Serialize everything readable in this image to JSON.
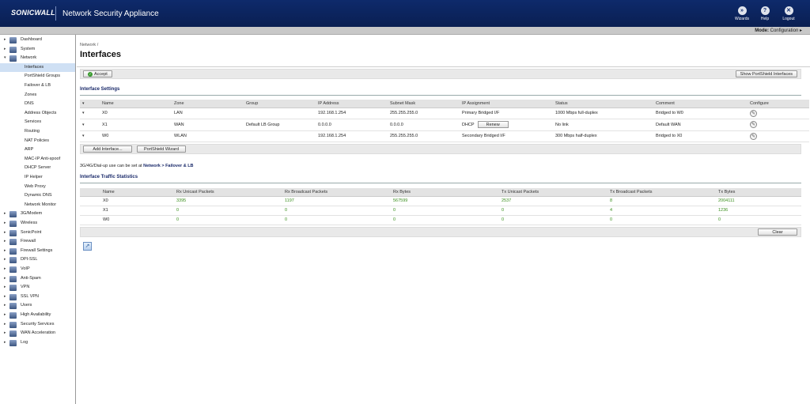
{
  "header": {
    "logo": "SONICWALL",
    "title": "Network Security Appliance",
    "buttons": [
      {
        "label": "Wizards",
        "icon": "wizard-icon"
      },
      {
        "label": "Help",
        "icon": "help-icon"
      },
      {
        "label": "Logout",
        "icon": "logout-icon"
      }
    ]
  },
  "mode": {
    "label": "Mode:",
    "value": "Configuration ▸"
  },
  "sidebar": {
    "items": [
      {
        "label": "Dashboard",
        "level": 0
      },
      {
        "label": "System",
        "level": 0
      },
      {
        "label": "Network",
        "level": 0,
        "expanded": true
      },
      {
        "label": "Interfaces",
        "level": 1,
        "active": true
      },
      {
        "label": "PortShield Groups",
        "level": 1
      },
      {
        "label": "Failover & LB",
        "level": 1
      },
      {
        "label": "Zones",
        "level": 1
      },
      {
        "label": "DNS",
        "level": 1
      },
      {
        "label": "Address Objects",
        "level": 1
      },
      {
        "label": "Services",
        "level": 1
      },
      {
        "label": "Routing",
        "level": 1
      },
      {
        "label": "NAT Policies",
        "level": 1
      },
      {
        "label": "ARP",
        "level": 1
      },
      {
        "label": "MAC-IP Anti-spoof",
        "level": 1
      },
      {
        "label": "DHCP Server",
        "level": 1
      },
      {
        "label": "IP Helper",
        "level": 1
      },
      {
        "label": "Web Proxy",
        "level": 1
      },
      {
        "label": "Dynamic DNS",
        "level": 1
      },
      {
        "label": "Network Monitor",
        "level": 1
      },
      {
        "label": "3G/Modem",
        "level": 0
      },
      {
        "label": "Wireless",
        "level": 0
      },
      {
        "label": "SonicPoint",
        "level": 0
      },
      {
        "label": "Firewall",
        "level": 0
      },
      {
        "label": "Firewall Settings",
        "level": 0
      },
      {
        "label": "DPI-SSL",
        "level": 0
      },
      {
        "label": "VoIP",
        "level": 0
      },
      {
        "label": "Anti-Spam",
        "level": 0
      },
      {
        "label": "VPN",
        "level": 0
      },
      {
        "label": "SSL VPN",
        "level": 0
      },
      {
        "label": "Users",
        "level": 0
      },
      {
        "label": "High Availability",
        "level": 0
      },
      {
        "label": "Security Services",
        "level": 0
      },
      {
        "label": "WAN Acceleration",
        "level": 0
      },
      {
        "label": "Log",
        "level": 0
      }
    ]
  },
  "main": {
    "breadcrumb": "Network /",
    "title": "Interfaces",
    "accept_label": "Accept",
    "show_portshield_label": "Show PortShield Interfaces",
    "settings_title": "Interface Settings",
    "settings_columns": [
      "Name",
      "Zone",
      "Group",
      "IP Address",
      "Subnet Mask",
      "IP Assignment",
      "Status",
      "Comment",
      "Configure"
    ],
    "settings_rows": [
      {
        "name": "X0",
        "zone": "LAN",
        "group": "",
        "ip": "192.168.1.254",
        "mask": "255.255.255.0",
        "assignment": "Primary Bridged I/F",
        "status": "1000 Mbps full-duplex",
        "comment": "Bridged to W0"
      },
      {
        "name": "X1",
        "zone": "WAN",
        "group": "Default LB Group",
        "ip": "0.0.0.0",
        "mask": "0.0.0.0",
        "assignment": "DHCP",
        "renew": "Renew",
        "status": "No link",
        "comment": "Default WAN"
      },
      {
        "name": "W0",
        "zone": "WLAN",
        "group": "",
        "ip": "192.168.1.254",
        "mask": "255.255.255.0",
        "assignment": "Secondary Bridged I/F",
        "status": "300 Mbps half-duplex",
        "comment": "Bridged to X0"
      }
    ],
    "add_interface_label": "Add Interface...",
    "portshield_wizard_label": "PortShield Wizard",
    "note_text": "3G/4G/Dial-up use can be set at ",
    "note_link": "Network > Failover & LB",
    "stats_title": "Interface Traffic Statistics",
    "stats_columns": [
      "Name",
      "Rx Unicast Packets",
      "Rx Broadcast Packets",
      "Rx Bytes",
      "Tx Unicast Packets",
      "Tx Broadcast Packets",
      "Tx Bytes"
    ],
    "stats_rows": [
      {
        "name": "X0",
        "rx_uni": "3395",
        "rx_bc": "1197",
        "rx_bytes": "567599",
        "tx_uni": "2537",
        "tx_bc": "8",
        "tx_bytes": "2004111"
      },
      {
        "name": "X1",
        "rx_uni": "0",
        "rx_bc": "0",
        "rx_bytes": "0",
        "tx_uni": "0",
        "tx_bc": "4",
        "tx_bytes": "1236"
      },
      {
        "name": "W0",
        "rx_uni": "0",
        "rx_bc": "0",
        "rx_bytes": "0",
        "tx_uni": "0",
        "tx_bc": "0",
        "tx_bytes": "0"
      }
    ],
    "clear_label": "Clear"
  },
  "colors": {
    "header": "#0e2a6b",
    "accent_link": "#1a2a6a",
    "stat_value": "#3a8f1d",
    "active_nav": "#cfe0f4"
  }
}
